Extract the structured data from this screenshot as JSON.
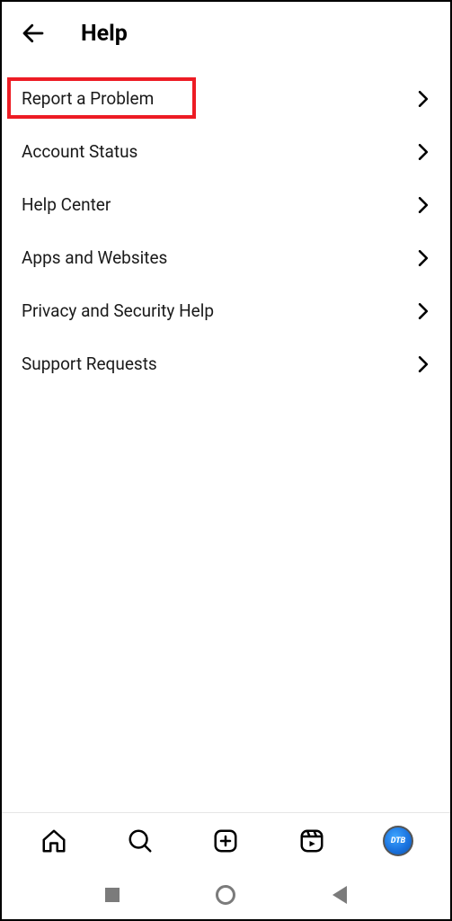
{
  "header": {
    "title": "Help"
  },
  "menu": {
    "items": [
      {
        "label": "Report a Problem",
        "highlighted": true
      },
      {
        "label": "Account Status"
      },
      {
        "label": "Help Center"
      },
      {
        "label": "Apps and Websites"
      },
      {
        "label": "Privacy and Security Help"
      },
      {
        "label": "Support Requests"
      }
    ]
  },
  "avatar": {
    "text": "DTB"
  }
}
